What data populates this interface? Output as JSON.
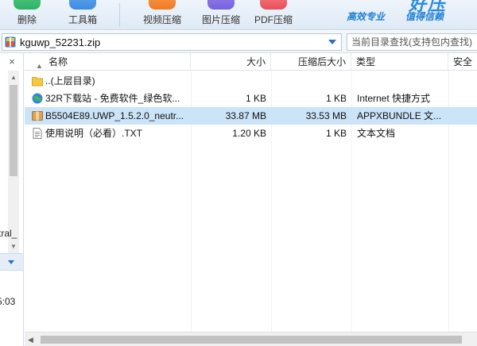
{
  "toolbar": {
    "buttons": [
      {
        "label": "删除",
        "icon": "delete-icon"
      },
      {
        "label": "工具箱",
        "icon": "toolbox-icon"
      },
      {
        "label": "视频压缩",
        "icon": "video-compress-icon"
      },
      {
        "label": "图片压缩",
        "icon": "image-compress-icon"
      },
      {
        "label": "PDF压缩",
        "icon": "pdf-compress-icon"
      }
    ],
    "promo": {
      "line1": "高效专业",
      "line2": "值得信赖"
    },
    "colors": {
      "accent": "#2a8ae0"
    }
  },
  "address": {
    "path": "kguwp_52231.zip",
    "search_placeholder": "当前目录查找(支持包内查找)"
  },
  "left_pane": {
    "close_glyph": "×",
    "text_fragments": [
      "tral_",
      "5:03"
    ]
  },
  "file_list": {
    "columns": {
      "name": "名称",
      "size": "大小",
      "compressed": "压缩后大小",
      "type": "类型",
      "security": "安全"
    },
    "rows": [
      {
        "icon": "folder-icon",
        "name": "..(上层目录)",
        "size": "",
        "compressed": "",
        "type": ""
      },
      {
        "icon": "internet-shortcut-icon",
        "name": "32R下载站 - 免费软件_绿色软...",
        "size": "1 KB",
        "compressed": "1 KB",
        "type": "Internet 快捷方式"
      },
      {
        "icon": "package-icon",
        "name": "B5504E89.UWP_1.5.2.0_neutr...",
        "size": "33.87 MB",
        "compressed": "33.53 MB",
        "type": "APPXBUNDLE 文...",
        "selected": true
      },
      {
        "icon": "text-file-icon",
        "name": "使用说明（必看）.TXT",
        "size": "1.20 KB",
        "compressed": "1 KB",
        "type": "文本文档"
      }
    ]
  }
}
